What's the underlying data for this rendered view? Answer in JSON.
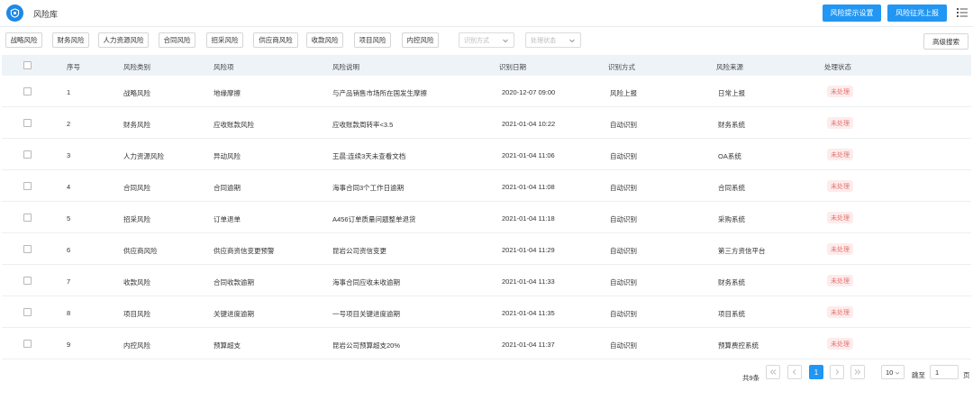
{
  "app": {
    "title": "风险库",
    "logo_icon": "shield-icon"
  },
  "toolbar": {
    "settings_label": "风险提示设置",
    "report_label": "风险征兆上报",
    "menu_icon": "list-menu-icon"
  },
  "filters": {
    "chips": [
      "战略风险",
      "财务风险",
      "人力资源风险",
      "合同风险",
      "招采风险",
      "供应商风险",
      "收款风险",
      "项目风险",
      "内控风险"
    ],
    "method_placeholder": "识别方式",
    "status_placeholder": "处理状态",
    "advanced_label": "高级搜索"
  },
  "table": {
    "headers": [
      "序号",
      "风险类别",
      "风险项",
      "风险说明",
      "识别日期",
      "识别方式",
      "风险来源",
      "处理状态"
    ],
    "rows": [
      {
        "no": "1",
        "category": "战略风险",
        "item": "地缘摩擦",
        "desc": "与产品销售市场所在国发生摩擦",
        "date": "2020-12-07 09:00",
        "method": "风险上报",
        "source": "日常上报",
        "status": "未处理"
      },
      {
        "no": "2",
        "category": "财务风险",
        "item": "应收账款风险",
        "desc": "应收账款周转率<3.5",
        "date": "2021-01-04 10:22",
        "method": "自动识别",
        "source": "财务系统",
        "status": "未处理"
      },
      {
        "no": "3",
        "category": "人力资源风险",
        "item": "异动风险",
        "desc": "王晨:连续3天未查看文档",
        "date": "2021-01-04 11:06",
        "method": "自动识别",
        "source": "OA系统",
        "status": "未处理"
      },
      {
        "no": "4",
        "category": "合同风险",
        "item": "合同逾期",
        "desc": "海事合同3个工作日逾期",
        "date": "2021-01-04 11:08",
        "method": "自动识别",
        "source": "合同系统",
        "status": "未处理"
      },
      {
        "no": "5",
        "category": "招采风险",
        "item": "订单退单",
        "desc": "A456订单质量问题整单退货",
        "date": "2021-01-04 11:18",
        "method": "自动识别",
        "source": "采购系统",
        "status": "未处理"
      },
      {
        "no": "6",
        "category": "供应商风险",
        "item": "供应商资信变更预警",
        "desc": "昆岩公司资信变更",
        "date": "2021-01-04 11:29",
        "method": "自动识别",
        "source": "第三方资信平台",
        "status": "未处理"
      },
      {
        "no": "7",
        "category": "收款风险",
        "item": "合同收款逾期",
        "desc": "海事合同应收未收逾期",
        "date": "2021-01-04 11:33",
        "method": "自动识别",
        "source": "财务系统",
        "status": "未处理"
      },
      {
        "no": "8",
        "category": "项目风险",
        "item": "关键进度逾期",
        "desc": "一号项目关键进度逾期",
        "date": "2021-01-04 11:35",
        "method": "自动识别",
        "source": "项目系统",
        "status": "未处理"
      },
      {
        "no": "9",
        "category": "内控风险",
        "item": "预算超支",
        "desc": "昆岩公司预算超支20%",
        "date": "2021-01-04 11:37",
        "method": "自动识别",
        "source": "预算费控系统",
        "status": "未处理"
      }
    ]
  },
  "pagination": {
    "total_label": "共9条",
    "current_page": "1",
    "page_size": "10",
    "goto_label": "跳至",
    "goto_value": "1",
    "page_unit": "页"
  },
  "colors": {
    "accent": "#2196f3",
    "status_bg": "#fdecec",
    "status_text": "#e57373",
    "header_bg": "#eef3f8"
  }
}
